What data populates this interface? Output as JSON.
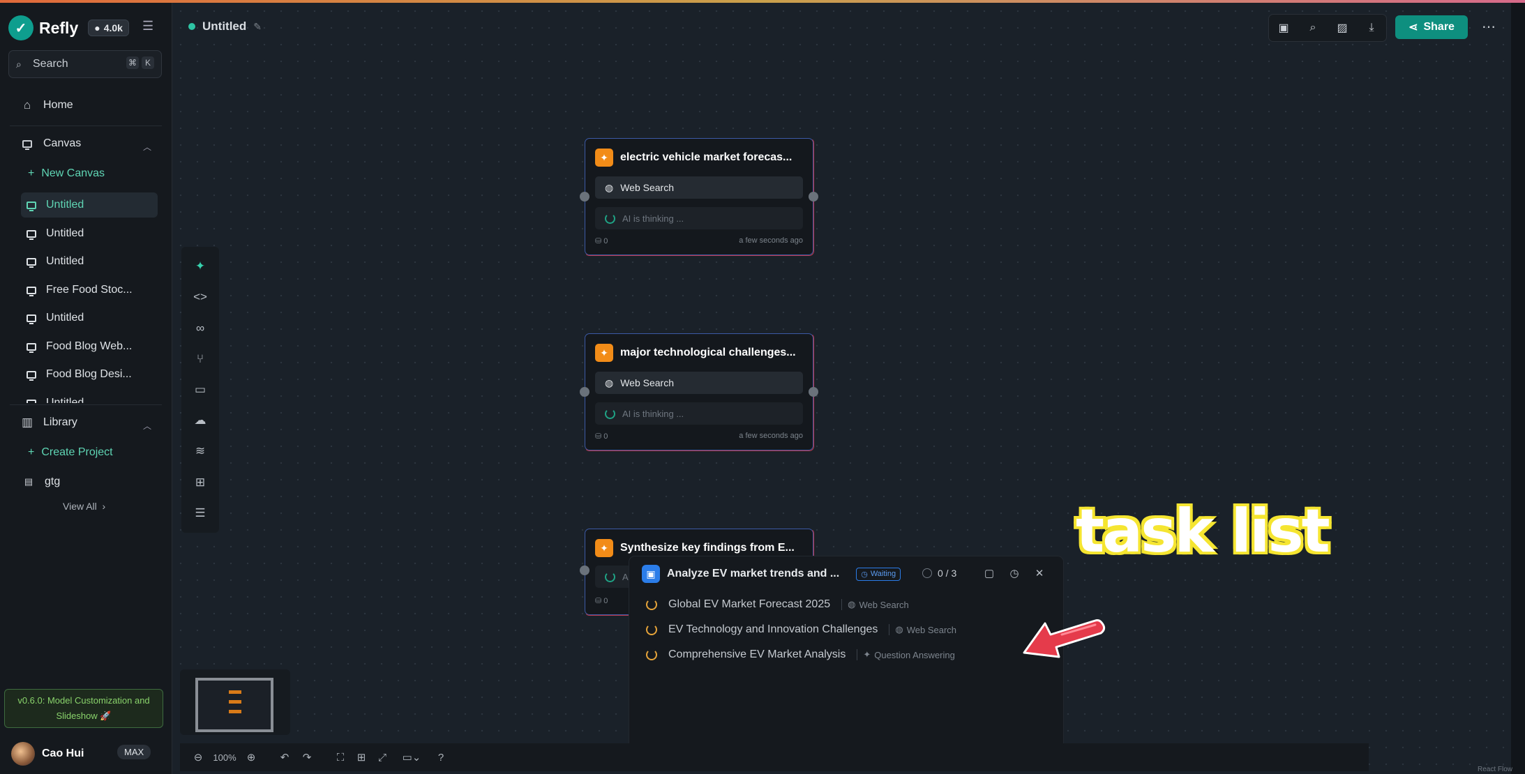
{
  "app": {
    "name": "Refly",
    "github_stars": "4.0k",
    "search_placeholder": "Search",
    "search_shortcut": [
      "⌘",
      "K"
    ]
  },
  "sidebar": {
    "home_label": "Home",
    "canvas_section_label": "Canvas",
    "new_canvas_label": "New Canvas",
    "canvases": [
      {
        "label": "Untitled",
        "active": true
      },
      {
        "label": "Untitled",
        "active": false
      },
      {
        "label": "Untitled",
        "active": false
      },
      {
        "label": "Free Food Stoc...",
        "active": false
      },
      {
        "label": "Untitled",
        "active": false
      },
      {
        "label": "Food Blog Web...",
        "active": false
      },
      {
        "label": "Food Blog Desi...",
        "active": false
      },
      {
        "label": "Untitled",
        "active": false
      }
    ],
    "library_section_label": "Library",
    "create_project_label": "Create Project",
    "projects": [
      {
        "label": "gtg"
      }
    ],
    "view_all_label": "View All",
    "version_notice": "v0.6.0: Model Customization and Slideshow 🚀",
    "user": {
      "name": "Cao Hui",
      "plan": "MAX"
    }
  },
  "header": {
    "canvas_title": "Untitled",
    "share_label": "Share",
    "toolbar_icons": [
      "presentation-icon",
      "search-icon",
      "image-icon",
      "download-icon"
    ]
  },
  "nodes": [
    {
      "title": "electric vehicle market forecas...",
      "tool": "Web Search",
      "status": "AI is thinking ...",
      "count": "0",
      "time": "a few seconds ago"
    },
    {
      "title": "major technological challenges...",
      "tool": "Web Search",
      "status": "AI is thinking ...",
      "count": "0",
      "time": "a few seconds ago"
    },
    {
      "title": "Synthesize key findings from E...",
      "tool": "",
      "status": "AI",
      "count": "0",
      "time": ""
    }
  ],
  "task_panel": {
    "title": "Analyze EV market trends and ...",
    "status_badge": "Waiting",
    "progress": "0 / 3",
    "tasks": [
      {
        "title": "Global EV Market Forecast 2025",
        "tool": "Web Search"
      },
      {
        "title": "EV Technology and Innovation Challenges",
        "tool": "Web Search"
      },
      {
        "title": "Comprehensive EV Market Analysis",
        "tool": "Question Answering"
      }
    ]
  },
  "annotation": {
    "text": "task list"
  },
  "bottom_bar": {
    "zoom_level": "100%"
  },
  "footer": {
    "attribution": "React Flow"
  },
  "colors": {
    "accent": "#0e8f7f",
    "node_icon": "#f28c18",
    "task_icon": "#2b7de9",
    "annotation_outline": "#f5e530",
    "arrow": "#e53b4b"
  }
}
